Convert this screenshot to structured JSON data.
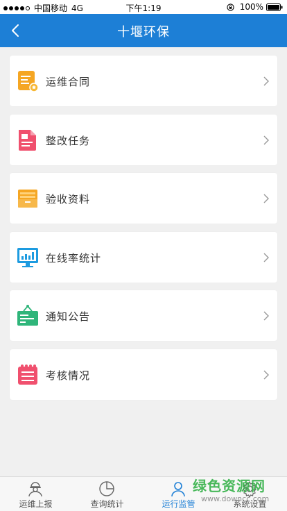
{
  "status_bar": {
    "carrier": "中国移动",
    "network": "4G",
    "time": "下午1:19",
    "battery": "100%"
  },
  "header": {
    "title": "十堰环保",
    "back_icon": "chevron-left-icon"
  },
  "menu": [
    {
      "label": "运维合同",
      "icon": "contract-document-icon",
      "color": "#f5a623"
    },
    {
      "label": "整改任务",
      "icon": "task-document-icon",
      "color": "#f0506e"
    },
    {
      "label": "验收资料",
      "icon": "folder-icon",
      "color": "#f5a623"
    },
    {
      "label": "在线率统计",
      "icon": "monitor-chart-icon",
      "color": "#1d9be0"
    },
    {
      "label": "通知公告",
      "icon": "notice-board-icon",
      "color": "#2fb57a"
    },
    {
      "label": "考核情况",
      "icon": "calendar-icon",
      "color": "#f0506e"
    }
  ],
  "tabs": [
    {
      "label": "运维上报",
      "icon": "worker-icon",
      "active": false
    },
    {
      "label": "查询统计",
      "icon": "pie-chart-icon",
      "active": false
    },
    {
      "label": "运行监管",
      "icon": "user-icon",
      "active": true
    },
    {
      "label": "系统设置",
      "icon": "gear-icon",
      "active": false
    }
  ],
  "watermark": {
    "main": "绿色资源网",
    "sub": "www.downcc.com"
  },
  "colors": {
    "accent": "#1d7fd6",
    "background": "#f0f0f0"
  }
}
